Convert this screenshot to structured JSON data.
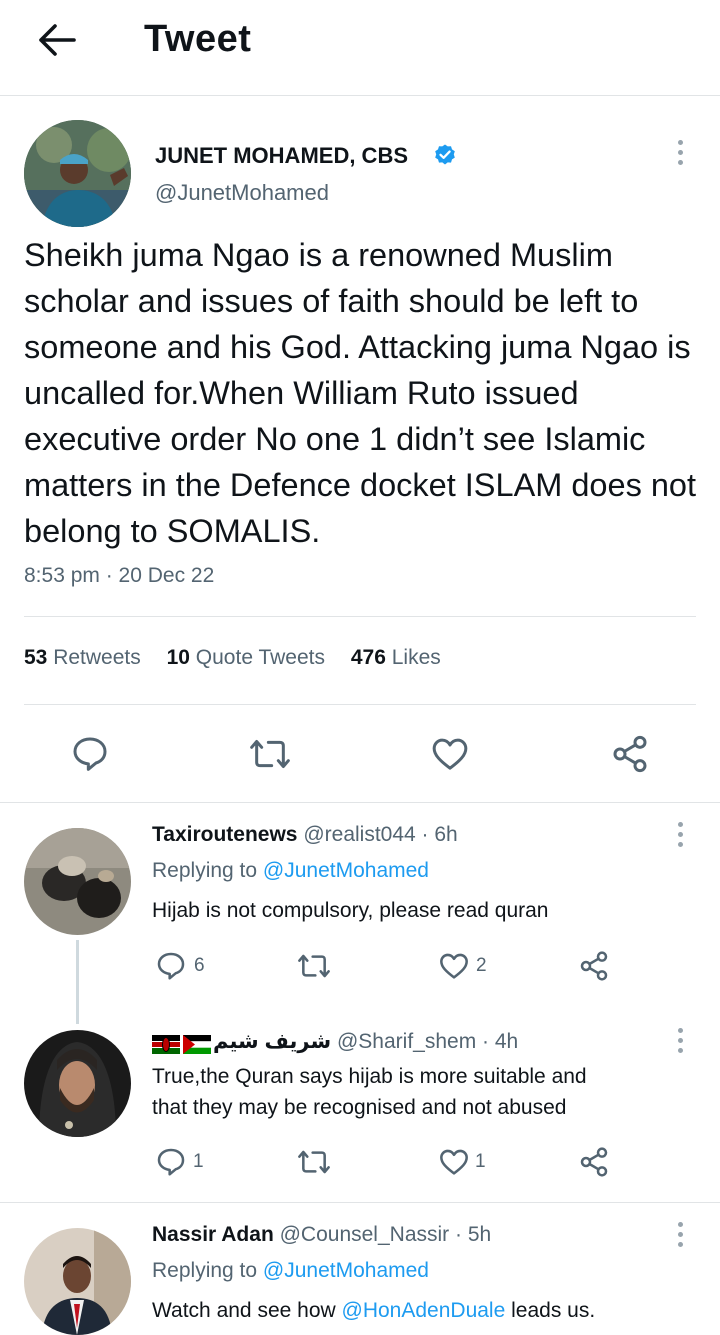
{
  "header": {
    "title": "Tweet"
  },
  "tweet": {
    "author": {
      "name": "JUNET MOHAMED, CBS",
      "handle": "@JunetMohamed",
      "verified": true
    },
    "text": "Sheikh juma Ngao is a renowned Muslim scholar and issues of faith should be left to someone and his God. Attacking juma Ngao is uncalled for.When William Ruto issued executive order No one 1 didn’t see Islamic matters in the Defence docket ISLAM does not belong to SOMALIS.",
    "timestamp": "8:53 pm · 20 Dec 22",
    "stats": {
      "retweets_count": "53",
      "retweets_label": "Retweets",
      "quotes_count": "10",
      "quotes_label": "Quote Tweets",
      "likes_count": "476",
      "likes_label": "Likes"
    }
  },
  "replies": [
    {
      "name": "Taxiroutenews",
      "meta": "@realist044 · 6h",
      "replying_prefix": "Replying to",
      "replying_handle": "@JunetMohamed",
      "text": "Hijab is not compulsory, please read quran",
      "reply_count": "6",
      "retweet_count": "",
      "like_count": "2"
    },
    {
      "name": "شريف شيم",
      "meta": "@Sharif_shem · 4h",
      "flags": [
        "kenya-flag",
        "palestine-flag"
      ],
      "text_line1": "True,the Quran says hijab is more suitable and",
      "text_line2": "that they may be recognised and not  abused",
      "reply_count": "1",
      "retweet_count": "",
      "like_count": "1"
    },
    {
      "name": "Nassir Adan",
      "meta": "@Counsel_Nassir · 5h",
      "replying_prefix": "Replying to",
      "replying_handle": "@JunetMohamed",
      "text_prefix": "Watch and see how",
      "text_mention": "@HonAdenDuale",
      "text_suffix": "leads us."
    }
  ],
  "colors": {
    "accent": "#1d9bf0",
    "muted": "#536471",
    "text": "#0f1419",
    "divider": "#e1e4e6"
  }
}
